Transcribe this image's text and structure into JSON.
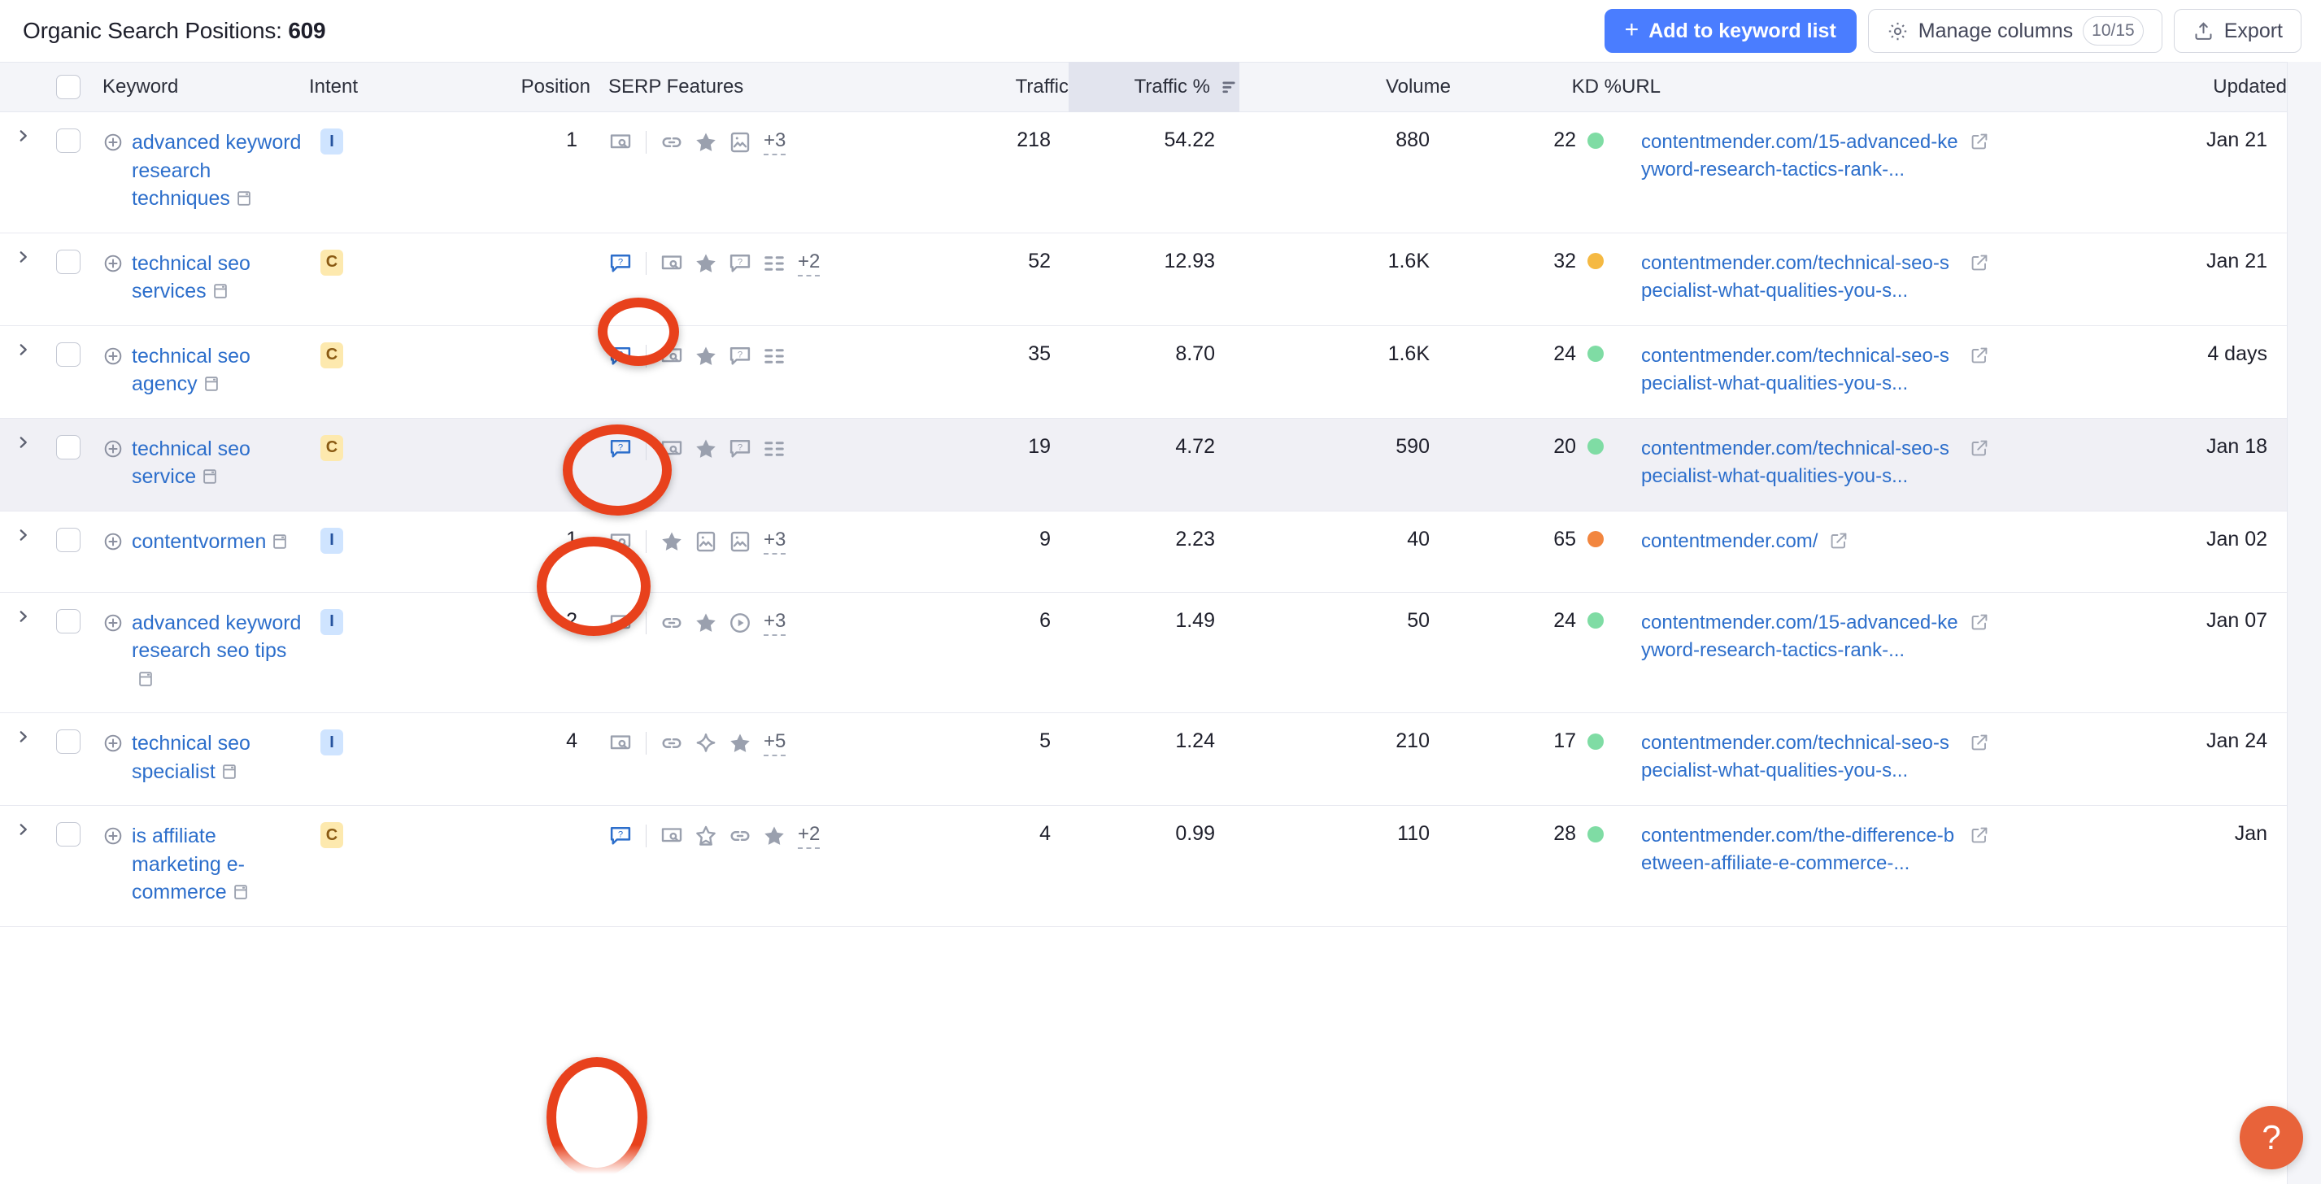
{
  "header": {
    "title_label": "Organic Search Positions:",
    "title_count": "609",
    "add_to_keyword_list_label": "Add to keyword list",
    "manage_columns_label": "Manage columns",
    "manage_columns_count": "10/15",
    "export_label": "Export"
  },
  "columns": {
    "keyword": "Keyword",
    "intent": "Intent",
    "position": "Position",
    "serp_features": "SERP Features",
    "traffic": "Traffic",
    "traffic_pct": "Traffic %",
    "volume": "Volume",
    "kd": "KD %",
    "url": "URL",
    "updated": "Updated"
  },
  "sorted_column": "Traffic %",
  "colors": {
    "accent_blue": "#4a7dff",
    "link_blue": "#2c6ecb",
    "annotation_red": "#e8411c",
    "help_orange": "#e8633a",
    "kd_green": "#7fdca4",
    "kd_yellow": "#f5b942",
    "kd_orange": "#f2863f",
    "intent_informational_bg": "#cfe4ff",
    "intent_commercial_bg": "#fde9ae"
  },
  "rows": [
    {
      "keyword": "advanced keyword research techniques",
      "intent": "I",
      "position": "1",
      "serp_features": [
        "serp-preview-icon",
        "link-icon",
        "star-icon",
        "image-pack-icon"
      ],
      "serp_more": "+3",
      "serp_highlight": false,
      "traffic": "218",
      "traffic_pct": "54.22",
      "volume": "880",
      "kd": "22",
      "kd_color": "green",
      "url": "contentmender.com/15-advanced-keyword-research-tactics-rank-...",
      "updated": "Jan 21",
      "highlighted_row": false
    },
    {
      "keyword": "technical seo services",
      "intent": "C",
      "position": "",
      "serp_features": [
        "people-also-ask-icon",
        "serp-preview-icon",
        "star-icon",
        "people-also-ask-icon",
        "list-icon"
      ],
      "serp_more": "+2",
      "serp_highlight": true,
      "traffic": "52",
      "traffic_pct": "12.93",
      "volume": "1.6K",
      "kd": "32",
      "kd_color": "yellow",
      "url": "contentmender.com/technical-seo-specialist-what-qualities-you-s...",
      "updated": "Jan 21",
      "highlighted_row": false
    },
    {
      "keyword": "technical seo agency",
      "intent": "C",
      "position": "",
      "serp_features": [
        "people-also-ask-icon",
        "serp-preview-icon",
        "star-icon",
        "people-also-ask-icon",
        "list-icon"
      ],
      "serp_more": "",
      "serp_highlight": true,
      "traffic": "35",
      "traffic_pct": "8.70",
      "volume": "1.6K",
      "kd": "24",
      "kd_color": "green",
      "url": "contentmender.com/technical-seo-specialist-what-qualities-you-s...",
      "updated": "4 days",
      "highlighted_row": false
    },
    {
      "keyword": "technical seo service",
      "intent": "C",
      "position": "",
      "serp_features": [
        "people-also-ask-icon",
        "serp-preview-icon",
        "star-icon",
        "people-also-ask-icon",
        "list-icon"
      ],
      "serp_more": "",
      "serp_highlight": true,
      "traffic": "19",
      "traffic_pct": "4.72",
      "volume": "590",
      "kd": "20",
      "kd_color": "green",
      "url": "contentmender.com/technical-seo-specialist-what-qualities-you-s...",
      "updated": "Jan 18",
      "highlighted_row": true
    },
    {
      "keyword": "contentvormen",
      "intent": "I",
      "position": "1",
      "serp_features": [
        "serp-preview-icon",
        "star-icon",
        "image-pack-icon",
        "image-pack-icon"
      ],
      "serp_more": "+3",
      "serp_highlight": false,
      "traffic": "9",
      "traffic_pct": "2.23",
      "volume": "40",
      "kd": "65",
      "kd_color": "orange",
      "url": "contentmender.com/",
      "updated": "Jan 02",
      "highlighted_row": false
    },
    {
      "keyword": "advanced keyword research seo tips",
      "intent": "I",
      "position": "2",
      "serp_features": [
        "serp-preview-icon",
        "link-icon",
        "star-icon",
        "video-icon"
      ],
      "serp_more": "+3",
      "serp_highlight": false,
      "traffic": "6",
      "traffic_pct": "1.49",
      "volume": "50",
      "kd": "24",
      "kd_color": "green",
      "url": "contentmender.com/15-advanced-keyword-research-tactics-rank-...",
      "updated": "Jan 07",
      "highlighted_row": false
    },
    {
      "keyword": "technical seo specialist",
      "intent": "I",
      "position": "4",
      "serp_features": [
        "serp-preview-icon",
        "link-icon",
        "ai-overview-icon",
        "star-icon"
      ],
      "serp_more": "+5",
      "serp_highlight": false,
      "traffic": "5",
      "traffic_pct": "1.24",
      "volume": "210",
      "kd": "17",
      "kd_color": "green",
      "url": "contentmender.com/technical-seo-specialist-what-qualities-you-s...",
      "updated": "Jan 24",
      "highlighted_row": false
    },
    {
      "keyword": "is affiliate marketing e-commerce",
      "intent": "C",
      "position": "",
      "serp_features": [
        "people-also-ask-icon",
        "serp-preview-icon",
        "review-icon",
        "link-icon",
        "star-icon"
      ],
      "serp_more": "+2",
      "serp_highlight": true,
      "traffic": "4",
      "traffic_pct": "0.99",
      "volume": "110",
      "kd": "28",
      "kd_color": "green",
      "url": "contentmender.com/the-difference-between-affiliate-e-commerce-...",
      "updated": "Jan",
      "highlighted_row": false
    }
  ],
  "help_button_label": "?"
}
